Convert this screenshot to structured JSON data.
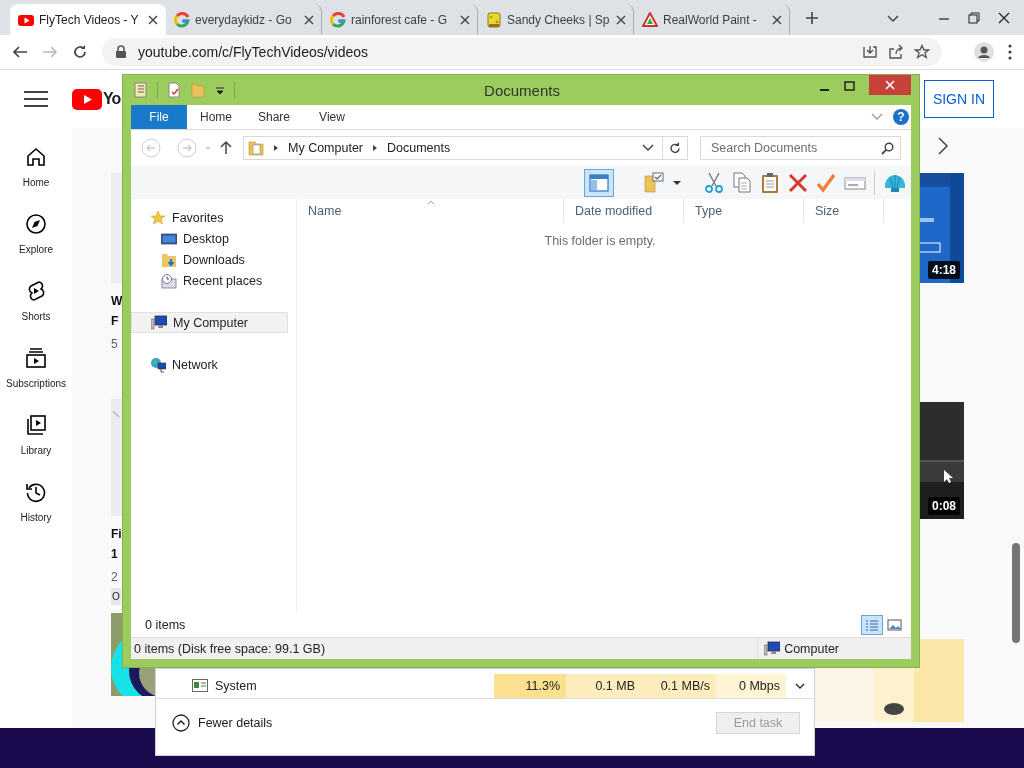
{
  "browser": {
    "tabs": [
      {
        "title": "FlyTech Videos - Y",
        "kind": "youtube",
        "selected": true
      },
      {
        "title": "everydaykidz - Go",
        "kind": "ring",
        "selected": false
      },
      {
        "title": "rainforest cafe - G",
        "kind": "ring",
        "selected": false
      },
      {
        "title": "Sandy Cheeks | Sp",
        "kind": "sponge",
        "selected": false
      },
      {
        "title": "RealWorld Paint -",
        "kind": "paint",
        "selected": false
      }
    ],
    "address": "youtube.com/c/FlyTechVideos/videos"
  },
  "youtube": {
    "logo_text": "Yo",
    "sign_in": "SIGN IN",
    "nav": [
      {
        "label": "Home",
        "kind": "home"
      },
      {
        "label": "Explore",
        "kind": "compass"
      },
      {
        "label": "Shorts",
        "kind": "shorts"
      },
      {
        "label": "Subscriptions",
        "kind": "subscriptions"
      },
      {
        "label": "Library",
        "kind": "library"
      },
      {
        "label": "History",
        "kind": "history"
      }
    ],
    "left_cards": [
      {
        "title_lines": [
          "W",
          "F"
        ],
        "meta": "5"
      },
      {
        "title_lines": [
          "Fi",
          "1"
        ],
        "meta": "2",
        "chip": "O"
      }
    ],
    "right_durations": [
      "4:18",
      "0:08"
    ]
  },
  "explorer": {
    "title": "Documents",
    "file_tab": "File",
    "ribbon_tabs": [
      "Home",
      "Share",
      "View"
    ],
    "help": "?",
    "path": [
      "My Computer",
      "Documents"
    ],
    "search": {
      "placeholder": "Search Documents"
    },
    "preview_pane_on": true,
    "nav": [
      {
        "label": "Favorites",
        "kind": "star",
        "selected": false,
        "children": [
          {
            "label": "Desktop",
            "kind": "desktop",
            "selected": false
          },
          {
            "label": "Downloads",
            "kind": "downloads",
            "selected": false
          },
          {
            "label": "Recent places",
            "kind": "recent",
            "selected": false
          }
        ]
      },
      {
        "label": "My Computer",
        "kind": "computer",
        "selected": true
      },
      {
        "label": "Network",
        "kind": "network",
        "selected": false
      }
    ],
    "columns": [
      "Name",
      "Date modified",
      "Type",
      "Size"
    ],
    "empty_message": "This folder is empty.",
    "item_count": "0 items",
    "details_view": true,
    "status": "0 items (Disk free space: 99.1 GB)",
    "location": "Computer"
  },
  "task_manager": {
    "row": {
      "name": "System",
      "cells": [
        {
          "text": "11.3%",
          "color": "#fbe08f"
        },
        {
          "text": "0.1 MB",
          "color": "#fdedbd"
        },
        {
          "text": "0.1 MB/s",
          "color": "#fdedbd"
        },
        {
          "text": "0 Mbps",
          "color": "#fff4d3"
        }
      ]
    },
    "fewer_details": "Fewer details",
    "end_task": {
      "label": "End task",
      "disabled": true
    }
  }
}
